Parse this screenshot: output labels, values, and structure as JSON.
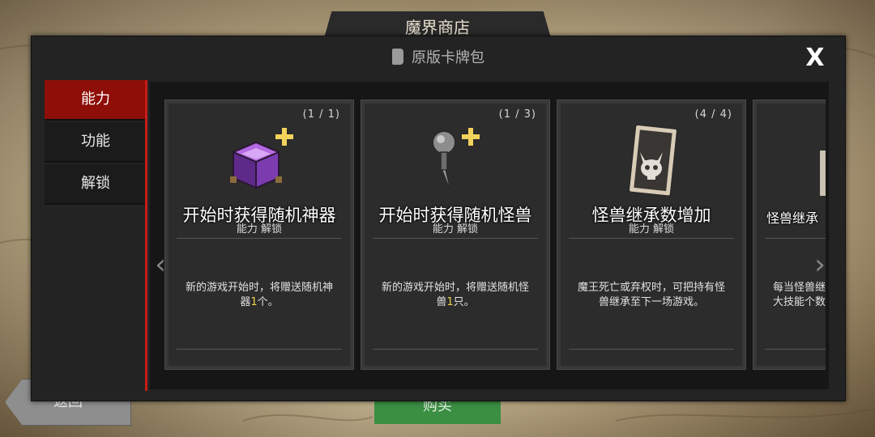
{
  "shop_title": "魔界商店",
  "back_label": "返回",
  "buy_label": "购买",
  "modal": {
    "title": "原版卡牌包",
    "close_label": "X"
  },
  "tabs": [
    {
      "label": "能力",
      "active": true
    },
    {
      "label": "功能",
      "active": false
    },
    {
      "label": "解锁",
      "active": false
    }
  ],
  "cards": [
    {
      "count": "(1 / 1)",
      "icon": "purple-crate-plus-icon",
      "name": "开始时获得随机神器",
      "sub": "能力 解锁",
      "desc_before": "新的游戏开始时，将赠送随机神器",
      "desc_highlight": "1",
      "desc_after": "个。"
    },
    {
      "count": "(1 / 3)",
      "icon": "pushpin-plus-icon",
      "name": "开始时获得随机怪兽",
      "sub": "能力 解锁",
      "desc_before": "新的游戏开始时，将赠送随机怪兽",
      "desc_highlight": "1",
      "desc_after": "只。"
    },
    {
      "count": "(4 / 4)",
      "icon": "demon-skull-card-icon",
      "name": "怪兽继承数增加",
      "sub": "能力 解锁",
      "desc_before": "魔王死亡或弃权时，可把持有怪兽继承至下一场游戏。",
      "desc_highlight": "",
      "desc_after": ""
    },
    {
      "count": "",
      "icon": "partial-card-icon",
      "name": "怪兽继承",
      "sub": "",
      "desc_before": "每当怪兽继大技能个数",
      "desc_highlight": "",
      "desc_after": ""
    }
  ],
  "colors": {
    "active_tab": "#8e0e08",
    "divider": "#c81b16",
    "highlight": "#f0d24a",
    "buy_button": "#3b8f43"
  }
}
